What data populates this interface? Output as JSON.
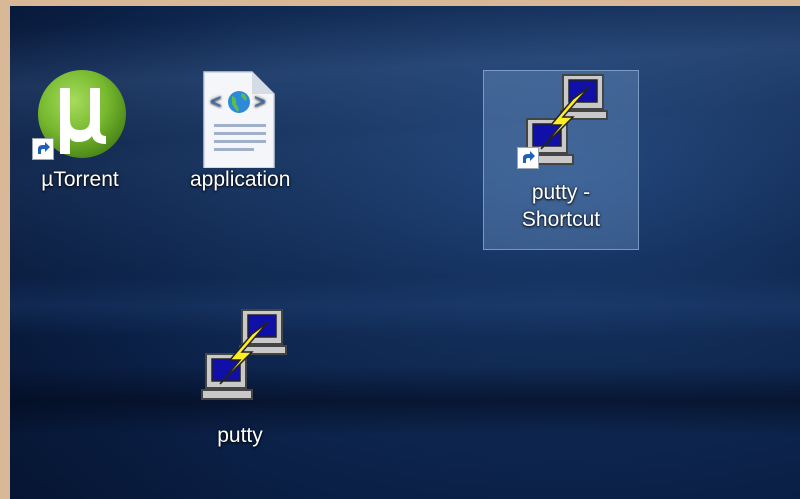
{
  "desktop": {
    "icons": [
      {
        "label": "µTorrent",
        "icon": "utorrent-icon",
        "shortcut": true,
        "selected": false
      },
      {
        "label": "application",
        "icon": "html-document-icon",
        "shortcut": false,
        "selected": false
      },
      {
        "label": "putty - Shortcut",
        "label_line1": "putty -",
        "label_line2": "Shortcut",
        "icon": "putty-icon",
        "shortcut": true,
        "selected": true
      },
      {
        "label": "putty",
        "icon": "putty-icon",
        "shortcut": false,
        "selected": false
      }
    ]
  },
  "colors": {
    "utorrent_green": "#77b830",
    "selection": "#7aa0d2",
    "desktop_blue": "#0b2148"
  }
}
